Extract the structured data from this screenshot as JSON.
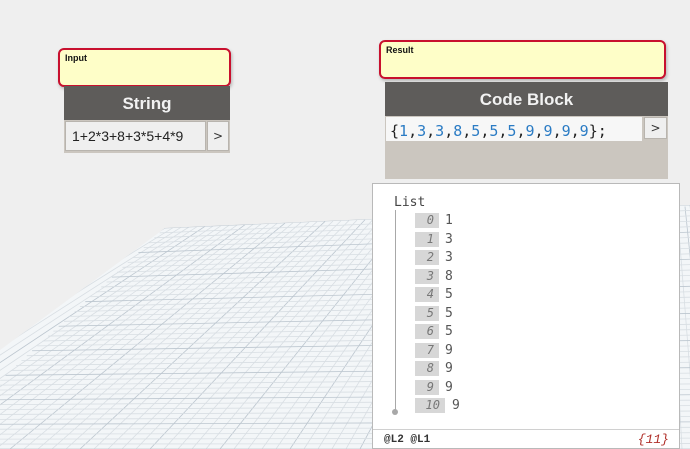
{
  "input_note": {
    "label": "Input"
  },
  "string_node": {
    "title": "String",
    "value": "1+2*3+8+3*5+4*9",
    "output_port": ">"
  },
  "result_note": {
    "label": "Result"
  },
  "code_block": {
    "title": "Code Block",
    "output_port": ">",
    "tokens": [
      "{",
      "1",
      ",",
      "3",
      ",",
      "3",
      ",",
      "8",
      ",",
      "5",
      ",",
      "5",
      ",",
      "5",
      ",",
      "9",
      ",",
      "9",
      ",",
      "9",
      ",",
      "9",
      "};"
    ]
  },
  "watch": {
    "title": "List",
    "items": [
      {
        "index": "0",
        "value": "1"
      },
      {
        "index": "1",
        "value": "3"
      },
      {
        "index": "2",
        "value": "3"
      },
      {
        "index": "3",
        "value": "8"
      },
      {
        "index": "4",
        "value": "5"
      },
      {
        "index": "5",
        "value": "5"
      },
      {
        "index": "6",
        "value": "5"
      },
      {
        "index": "7",
        "value": "9"
      },
      {
        "index": "8",
        "value": "9"
      },
      {
        "index": "9",
        "value": "9"
      },
      {
        "index": "10",
        "value": "9"
      }
    ],
    "levels": "@L2 @L1",
    "count": "{11}"
  },
  "colors": {
    "note_fill": "#fefec8",
    "note_border": "#c8102e",
    "node_header": "#5e5c5a",
    "code_number": "#2a7bc4",
    "count_text": "#b0302a"
  }
}
